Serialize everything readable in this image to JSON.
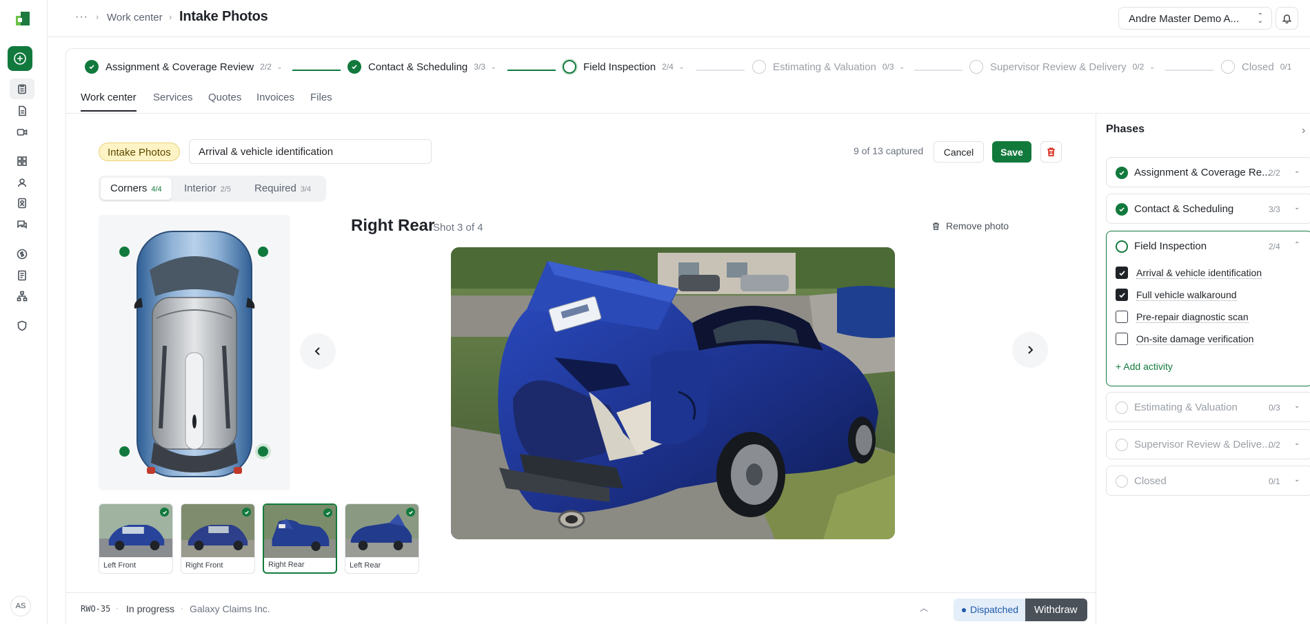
{
  "user": {
    "initials": "AS"
  },
  "breadcrumb": {
    "dots": "···",
    "parent": "Work center",
    "current": "Intake Photos"
  },
  "account": {
    "name": "Andre Master Demo A..."
  },
  "colors": {
    "brand": "#12793d",
    "accent_light": "#cfe6d6",
    "danger": "#d92d20",
    "tag_bg": "#fdf3c4",
    "dispatched_bg": "#e4eef9"
  },
  "stepper": [
    {
      "name": "Assignment & Coverage Review",
      "count": "2/2",
      "state": "done"
    },
    {
      "name": "Contact & Scheduling",
      "count": "3/3",
      "state": "done"
    },
    {
      "name": "Field Inspection",
      "count": "2/4",
      "state": "current"
    },
    {
      "name": "Estimating & Valuation",
      "count": "0/3",
      "state": "future"
    },
    {
      "name": "Supervisor Review & Delivery",
      "count": "0/2",
      "state": "future"
    },
    {
      "name": "Closed",
      "count": "0/1",
      "state": "future"
    }
  ],
  "tabs": [
    {
      "label": "Work center",
      "active": true
    },
    {
      "label": "Services"
    },
    {
      "label": "Quotes"
    },
    {
      "label": "Invoices"
    },
    {
      "label": "Files"
    }
  ],
  "editor": {
    "tag": "Intake Photos",
    "title_value": "Arrival & vehicle identification",
    "captured": "9 of 13 captured",
    "cancel": "Cancel",
    "save": "Save"
  },
  "segments": [
    {
      "label": "Corners",
      "count": "4/4",
      "active": true
    },
    {
      "label": "Interior",
      "count": "2/5"
    },
    {
      "label": "Required",
      "count": "3/4"
    }
  ],
  "viewer": {
    "shot_name": "Right Rear",
    "shot_position": "Shot 3 of 4",
    "remove": "Remove photo"
  },
  "thumbnails": [
    {
      "label": "Left Front",
      "captured": true
    },
    {
      "label": "Right Front",
      "captured": true
    },
    {
      "label": "Right Rear",
      "captured": true,
      "selected": true
    },
    {
      "label": "Left Rear",
      "captured": true
    }
  ],
  "footer": {
    "id": "RWO-35",
    "sep": "·",
    "status": "In progress",
    "client": "Galaxy Claims Inc.",
    "dispatched": "Dispatched",
    "withdraw": "Withdraw"
  },
  "panel": {
    "title": "Phases",
    "phases": [
      {
        "name": "Assignment & Coverage Re...",
        "count": "2/2",
        "state": "done"
      },
      {
        "name": "Contact & Scheduling",
        "count": "3/3",
        "state": "done"
      },
      {
        "name": "Field Inspection",
        "count": "2/4",
        "state": "current",
        "activities": [
          {
            "label": "Arrival & vehicle identification",
            "checked": true
          },
          {
            "label": "Full vehicle walkaround",
            "checked": true
          },
          {
            "label": "Pre-repair diagnostic scan",
            "checked": false
          },
          {
            "label": "On-site damage verification",
            "checked": false
          }
        ],
        "add_activity": "+ Add activity"
      },
      {
        "name": "Estimating & Valuation",
        "count": "0/3",
        "state": "future"
      },
      {
        "name": "Supervisor Review & Delive...",
        "count": "0/2",
        "state": "future"
      },
      {
        "name": "Closed",
        "count": "0/1",
        "state": "future"
      }
    ]
  }
}
